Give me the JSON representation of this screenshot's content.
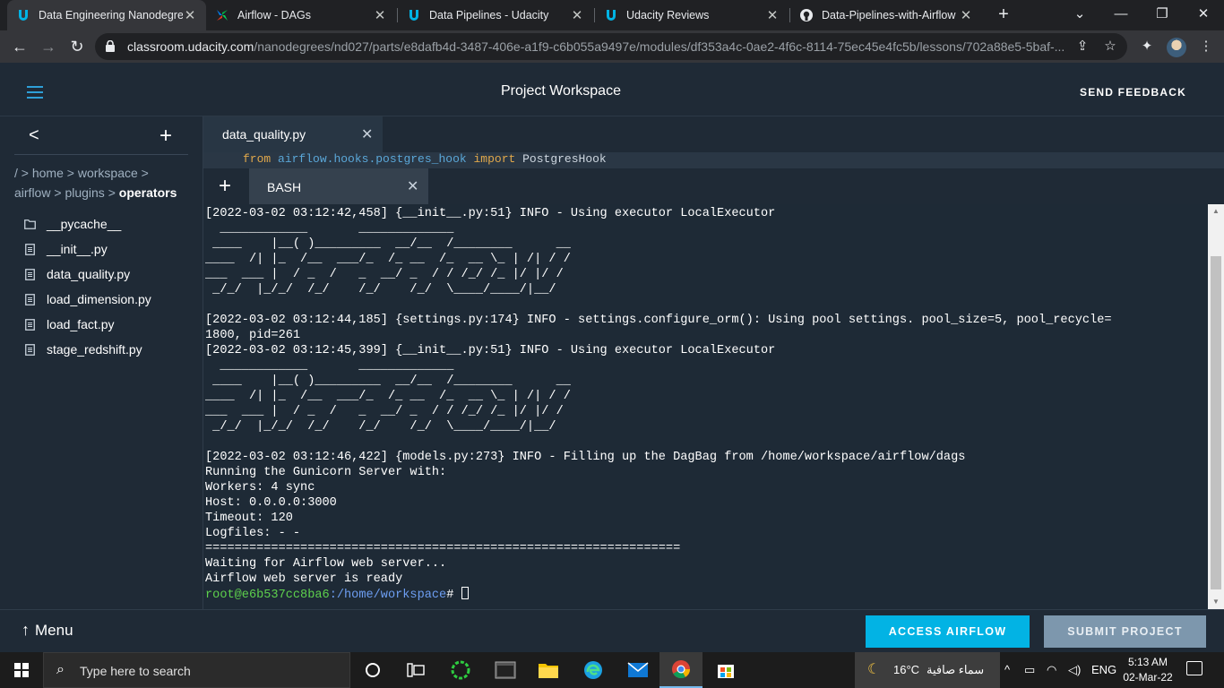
{
  "browser": {
    "tabs": [
      {
        "title": "Data Engineering Nanodegree",
        "active": true,
        "icon": "udacity-icon"
      },
      {
        "title": "Airflow - DAGs",
        "active": false,
        "icon": "airflow-icon"
      },
      {
        "title": "Data Pipelines - Udacity",
        "active": false,
        "icon": "udacity-icon"
      },
      {
        "title": "Udacity Reviews",
        "active": false,
        "icon": "udacity-icon"
      },
      {
        "title": "Data-Pipelines-with-Airflow",
        "active": false,
        "icon": "github-icon"
      }
    ],
    "url_host": "classroom.udacity.com",
    "url_path": "/nanodegrees/nd027/parts/e8dafb4d-3487-406e-a1f9-c6b055a9497e/modules/df353a4c-0ae2-4f6c-8114-75ec45e4fc5b/lessons/702a88e5-5baf-..."
  },
  "header": {
    "title": "Project Workspace",
    "feedback_label": "SEND FEEDBACK"
  },
  "sidebar": {
    "breadcrumb": {
      "sep": ">",
      "root": "/",
      "home": "home",
      "workspace": "workspace",
      "airflow": "airflow",
      "plugins": "plugins",
      "current": "operators"
    },
    "files": [
      {
        "name": "__pycache__",
        "type": "folder"
      },
      {
        "name": "__init__.py",
        "type": "file"
      },
      {
        "name": "data_quality.py",
        "type": "file"
      },
      {
        "name": "load_dimension.py",
        "type": "file"
      },
      {
        "name": "load_fact.py",
        "type": "file"
      },
      {
        "name": "stage_redshift.py",
        "type": "file"
      }
    ]
  },
  "editor": {
    "tab_label": "data_quality.py",
    "code_from": "from",
    "code_module": "airflow.hooks.postgres_hook",
    "code_import": "import",
    "code_name": "PostgresHook"
  },
  "terminal": {
    "tab_label": "BASH",
    "lines": [
      "[2022-03-02 03:12:42,458] {__init__.py:51} INFO - Using executor LocalExecutor",
      "  ____________       _____________",
      " ____    |__( )_________  __/__  /________      __",
      "____  /| |_  /__  ___/_  /_ __  /_  __ \\_ | /| / /",
      "___  ___ |  / _  /   _  __/ _  / / /_/ /_ |/ |/ /",
      " _/_/  |_/_/  /_/    /_/    /_/  \\____/____/|__/",
      "",
      "[2022-03-02 03:12:44,185] {settings.py:174} INFO - settings.configure_orm(): Using pool settings. pool_size=5, pool_recycle=",
      "1800, pid=261",
      "[2022-03-02 03:12:45,399] {__init__.py:51} INFO - Using executor LocalExecutor",
      "  ____________       _____________",
      " ____    |__( )_________  __/__  /________      __",
      "____  /| |_  /__  ___/_  /_ __  /_  __ \\_ | /| / /",
      "___  ___ |  / _  /   _  __/ _  / / /_/ /_ |/ |/ /",
      " _/_/  |_/_/  /_/    /_/    /_/  \\____/____/|__/",
      "",
      "[2022-03-02 03:12:46,422] {models.py:273} INFO - Filling up the DagBag from /home/workspace/airflow/dags",
      "Running the Gunicorn Server with:",
      "Workers: 4 sync",
      "Host: 0.0.0.0:3000",
      "Timeout: 120",
      "Logfiles: - -",
      "=================================================================",
      "Waiting for Airflow web server...",
      "Airflow web server is ready"
    ],
    "prompt_user": "root@e6b537cc8ba6",
    "prompt_path": ":/home/workspace",
    "prompt_symbol": "# "
  },
  "footer": {
    "menu_label": "Menu",
    "access_airflow_label": "ACCESS AIRFLOW",
    "submit_label": "SUBMIT PROJECT"
  },
  "taskbar": {
    "search_placeholder": "Type here to search",
    "weather_temp": "16°C",
    "weather_condition": "سماء صافية",
    "language": "ENG",
    "time": "5:13 AM",
    "date": "02-Mar-22"
  },
  "colors": {
    "accent": "#02b3e4",
    "submit_bg": "#7d97ad",
    "app_bg": "#1f2a36",
    "prompt_user": "#5ed14d",
    "prompt_path": "#6d9ef2"
  }
}
